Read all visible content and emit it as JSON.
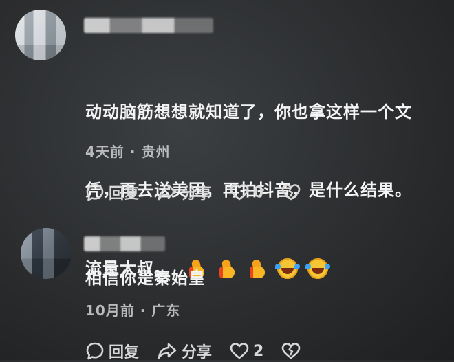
{
  "comments": [
    {
      "text": "动动脑筋想想就知道了，你也拿这样一个文凭，再去送美团，再拍抖音，是什么结果。流量大叔。",
      "line1": "动动脑筋想想就知道了，你也拿这样一个文",
      "line2": "凭，再去送美团，再拍抖音，是什么结果。",
      "line3": "流量大叔。",
      "emojis": [
        "thumbs-up",
        "thumbs-up",
        "thumbs-up",
        "laughing-crying",
        "laughing-crying"
      ],
      "meta": "4天前 · 贵州",
      "reply_label": "回复",
      "share_label": "分享",
      "like_count": "0"
    },
    {
      "text": "相信你是秦始皇",
      "meta": "10月前 · 广东",
      "reply_label": "回复",
      "share_label": "分享",
      "like_count": "2"
    }
  ],
  "colors": {
    "background": "#2b2d2f",
    "text": "#f4f4f4",
    "meta": "#b9bbbd",
    "action": "#d8d8d8"
  }
}
